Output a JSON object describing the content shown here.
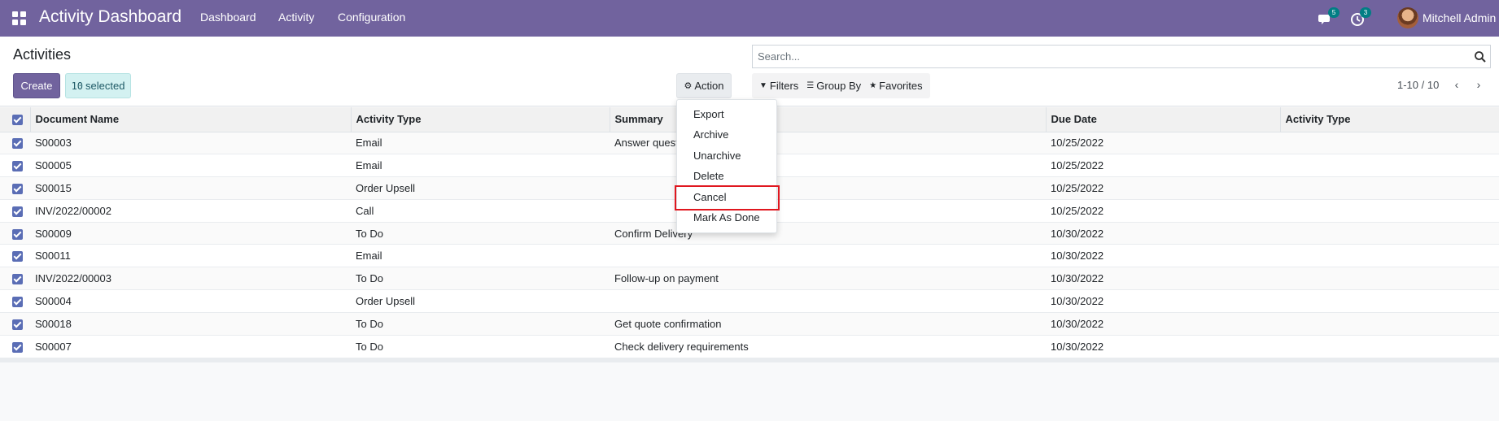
{
  "navbar": {
    "brand": "Activity Dashboard",
    "menu": [
      "Dashboard",
      "Activity",
      "Configuration"
    ],
    "messages_badge": "5",
    "activities_badge": "3",
    "user_name": "Mitchell Admin"
  },
  "control_panel": {
    "title": "Activities",
    "create_label": "Create",
    "selected_count": "10",
    "selected_label": "selected",
    "action_label": "Action",
    "search_placeholder": "Search...",
    "filters_label": "Filters",
    "group_by_label": "Group By",
    "favorites_label": "Favorites",
    "pager": "1-10 / 10"
  },
  "action_menu": {
    "items": [
      "Export",
      "Archive",
      "Unarchive",
      "Delete",
      "Cancel",
      "Mark As Done"
    ],
    "highlighted": "Cancel"
  },
  "table": {
    "headers": [
      "Document Name",
      "Activity Type",
      "Summary",
      "Due Date",
      "Activity Type"
    ],
    "rows": [
      {
        "doc": "S00003",
        "type": "Email",
        "summary": "Answer quest",
        "due": "10/25/2022",
        "type2": ""
      },
      {
        "doc": "S00005",
        "type": "Email",
        "summary": "",
        "due": "10/25/2022",
        "type2": ""
      },
      {
        "doc": "S00015",
        "type": "Order Upsell",
        "summary": "",
        "due": "10/25/2022",
        "type2": ""
      },
      {
        "doc": "INV/2022/00002",
        "type": "Call",
        "summary": "",
        "due": "10/25/2022",
        "type2": ""
      },
      {
        "doc": "S00009",
        "type": "To Do",
        "summary": "Confirm Delivery",
        "due": "10/30/2022",
        "type2": ""
      },
      {
        "doc": "S00011",
        "type": "Email",
        "summary": "",
        "due": "10/30/2022",
        "type2": ""
      },
      {
        "doc": "INV/2022/00003",
        "type": "To Do",
        "summary": "Follow-up on payment",
        "due": "10/30/2022",
        "type2": ""
      },
      {
        "doc": "S00004",
        "type": "Order Upsell",
        "summary": "",
        "due": "10/30/2022",
        "type2": ""
      },
      {
        "doc": "S00018",
        "type": "To Do",
        "summary": "Get quote confirmation",
        "due": "10/30/2022",
        "type2": ""
      },
      {
        "doc": "S00007",
        "type": "To Do",
        "summary": "Check delivery requirements",
        "due": "10/30/2022",
        "type2": ""
      }
    ]
  },
  "colors": {
    "navbar": "#71639e",
    "badge": "#017e84",
    "checkbox": "#5a6db5",
    "highlight": "#e0171f"
  }
}
